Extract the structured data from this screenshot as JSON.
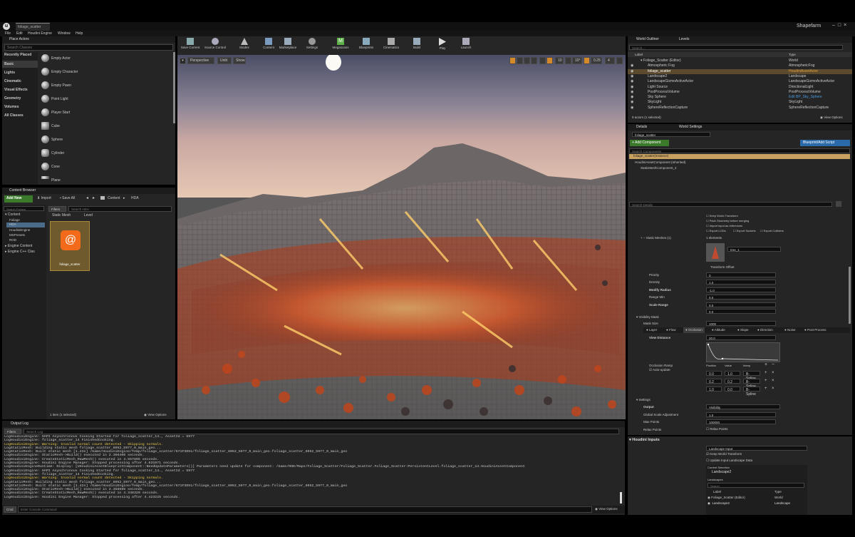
{
  "app": {
    "tab": "foliage_scatter",
    "user": "Shapefarm"
  },
  "menu": [
    "File",
    "Edit",
    "Houdini Engine",
    "Window",
    "Help"
  ],
  "place": {
    "title": "Place Actors",
    "search": "Search Classes",
    "categories": [
      "Recently Placed",
      "Basic",
      "Lights",
      "Cinematic",
      "Visual Effects",
      "Geometry",
      "Volumes",
      "All Classes"
    ],
    "items": [
      "Empty Actor",
      "Empty Character",
      "Empty Pawn",
      "Point Light",
      "Player Start",
      "Cube",
      "Sphere",
      "Cylinder",
      "Cone",
      "Plane"
    ]
  },
  "toolbar": [
    "Save Current",
    "Source Control",
    "Modes",
    "Content",
    "Marketplace",
    "Settings",
    "Megascans",
    "Blueprints",
    "Cinematics",
    "Build",
    "Play",
    "Launch"
  ],
  "viewport": {
    "perspective": "Perspective",
    "unlit": "Unlit",
    "show": "Show",
    "grid": "10",
    "angle": "10°",
    "scale": "0.25",
    "cam": "4"
  },
  "content": {
    "title": "Content Browser",
    "add_new": "Add New",
    "import": "Import",
    "save_all": "Save All",
    "path": [
      "Content",
      "HDA"
    ],
    "search_folders": "Search Folders",
    "filters": "Filters",
    "search": "Search HDA",
    "tree": [
      "Content",
      "Foliage",
      "HDA",
      "HoudiniEngine",
      "MSPresets",
      "ROD",
      "Engine Content",
      "Engine C++ Clas"
    ],
    "tabs": [
      "Static Mesh",
      "Level"
    ],
    "asset": "foliage_scatter",
    "status": "1 item (1 selected)",
    "view_options": "View Options"
  },
  "outliner": {
    "tab1": "World Outliner",
    "tab2": "Levels",
    "search": "Search...",
    "col_label": "Label",
    "col_type": "Type",
    "rows": [
      {
        "label": "Foliage_Scatter (Editor)",
        "type": "World"
      },
      {
        "label": "Atmospheric Fog",
        "type": "AtmosphericFog"
      },
      {
        "label": "foliage_scatter",
        "type": "HoudiniAssetActor"
      },
      {
        "label": "Landscape2",
        "type": "Landscape"
      },
      {
        "label": "LandscapeGizmoActiveActor",
        "type": "LandscapeGizmoActiveActor"
      },
      {
        "label": "Light Source",
        "type": "DirectionalLight"
      },
      {
        "label": "PostProcessVolume",
        "type": "PostProcessVolume"
      },
      {
        "label": "Sky Sphere",
        "type": "Edit BP_Sky_Sphere"
      },
      {
        "label": "SkyLight",
        "type": "SkyLight"
      },
      {
        "label": "SphereReflectionCapture",
        "type": "SphereReflectionCapture"
      }
    ],
    "status": "9 actors (1 selected)",
    "view_options": "View Options"
  },
  "details": {
    "tab1": "Details",
    "tab2": "World Settings",
    "name": "foliage_scatter",
    "add_component": "+ Add Component",
    "blueprint": "Blueprint/Add Script",
    "search_components": "Search Components",
    "instance": "foliage_scatter(Instance)",
    "comp1": "HoudiniAssetComponent (Inherited)",
    "comp2": "StaticMeshComponent_4",
    "search_details": "Search Details",
    "chk": [
      "Keep World Transform",
      "Pack Geometry before merging",
      "Import input as references",
      "Export LODs",
      "Export Sockets",
      "Export Colliders"
    ],
    "static_meshes": "Static Meshes (1)",
    "elements": "1 elements",
    "mesh": "tree_1",
    "transform_offset": "Transform Offset",
    "props": [
      {
        "k": "Priority",
        "v": "0"
      },
      {
        "k": "Density",
        "v": "1.0"
      },
      {
        "k": "Modify Radius",
        "v": "-1.0"
      },
      {
        "k": "Range Min",
        "v": "0.0"
      },
      {
        "k": "Scale Range",
        "v": "0.0"
      },
      {
        "k": "",
        "v": "0.0"
      }
    ],
    "visibility_mask": "Visibility Mask",
    "mask_size": "Mask Size",
    "mask_size_v": "1000",
    "mask_tabs": [
      "Layer",
      "Flow",
      "Occlusion",
      "Altitude",
      "Slope",
      "Direction",
      "Noise",
      "Post Process"
    ],
    "view_distance": "View Distance",
    "view_distance_v": "20.0",
    "ramp": "Occlusion Ramp",
    "auto_update": "Auto-update",
    "ramp_cols": [
      "Position",
      "Value",
      "Interp"
    ],
    "ramp_rows": [
      {
        "p": "0.0",
        "v": "1.0",
        "i": "B-Spline"
      },
      {
        "p": "0.2",
        "v": "0.2",
        "i": "B-Spline"
      },
      {
        "p": "1.0",
        "v": "0.0",
        "i": "B-Spline"
      }
    ],
    "settings": "Settings",
    "output": "Output",
    "output_v": "Visibility",
    "gsa": "Global Scale Adjustment",
    "gsa_v": "1.0",
    "max_points": "Max Points",
    "max_points_v": "100000",
    "relax": "Relax Points"
  },
  "houdini": {
    "title": "Houdini Inputs",
    "input_type": "Landscape Input",
    "keep": "Keep World Transform",
    "update": "Update Input Landscape Data",
    "current": "Current Selection",
    "current_v": "Landscape2",
    "landscapes": "Landscapes",
    "search": "Search",
    "col_label": "Label",
    "col_type": "Type",
    "rows": [
      {
        "label": "Foliage_Scatter (Editor)",
        "type": "World"
      },
      {
        "label": "Landscape2",
        "type": "Landscape"
      }
    ]
  },
  "output": {
    "title": "Output Log",
    "filters": "Filters",
    "search": "Search Log",
    "cmd": "Cmd",
    "cmd_placeholder": "Enter Console Command",
    "view_options": "View Options",
    "lines": [
      {
        "t": "LogHoudiniEngine: HAPI Asynchronous Cooking Started for foliage_scatter_14., AssetId = 5977",
        "w": false
      },
      {
        "t": "LogHoudiniEngine:    foliage_scatter_14 FinishedCooking.",
        "w": false
      },
      {
        "t": "LogHoudiniEngine: Warning: Invalid normal count detected - Skipping normals.",
        "w": true
      },
      {
        "t": "LogStaticMesh: Building static mesh foliage_scatter_6052_5977_0_main_geo...",
        "w": false
      },
      {
        "t": "LogStaticMesh: Built static mesh [1.43s] /Game/HoudiniEngine/Temp/foliage_scatter/671F3D51/foliage_scatter_6052_5977_0_main_geo.foliage_scatter_6052_5977_0_main_geo",
        "w": false
      },
      {
        "t": "LogHoudiniEngine: StaticMesh->Build() executed in 2.366406 seconds.",
        "w": false
      },
      {
        "t": "LogHoudiniEngine: CreateStaticMesh_RawMesh() executed in 4.557895 seconds.",
        "w": false
      },
      {
        "t": "LogHoudiniEngine: Houdini Engine Manager: Stopped processing after 4.631971 seconds.",
        "w": false
      },
      {
        "t": "LogHoudiniEngineRuntime: Display: [UHoudiniAssetBlueprintComponent::NeedUpdateParameters()] Parameters need update for component: /Game/ROD/Maps/Foliage_Scatter/Foliage_Scatter.Foliage_Scatter:PersistentLevel.foliage_scatter_14.HoudiniAssetComponent",
        "w": false
      },
      {
        "t": "LogHoudiniEngine: HAPI Asynchronous Cooking Started for foliage_scatter_14., AssetId = 5977",
        "w": false
      },
      {
        "t": "LogHoudiniEngine:    foliage_scatter_14 FinishedCooking.",
        "w": false
      },
      {
        "t": "LogHoudiniEngine: Warning: Invalid normal count detected - Skipping normals.",
        "w": true
      },
      {
        "t": "LogStaticMesh: Building static mesh foliage_scatter_6052_5977_0_main_geo...",
        "w": false
      },
      {
        "t": "LogStaticMesh: Built static mesh [1.42s] /Game/HoudiniEngine/Temp/foliage_scatter/671F3D51/foliage_scatter_6052_5977_0_main_geo.foliage_scatter_6052_5977_0_main_geo",
        "w": false
      },
      {
        "t": "LogHoudiniEngine: StaticMesh->Build() executed in 2.358665 seconds.",
        "w": false
      },
      {
        "t": "LogHoudiniEngine: CreateStaticMesh_RawMesh() executed in 4.348320 seconds.",
        "w": false
      },
      {
        "t": "LogHoudiniEngine: Houdini Engine Manager: Stopped processing after 4.423225 seconds.",
        "w": false
      }
    ]
  }
}
